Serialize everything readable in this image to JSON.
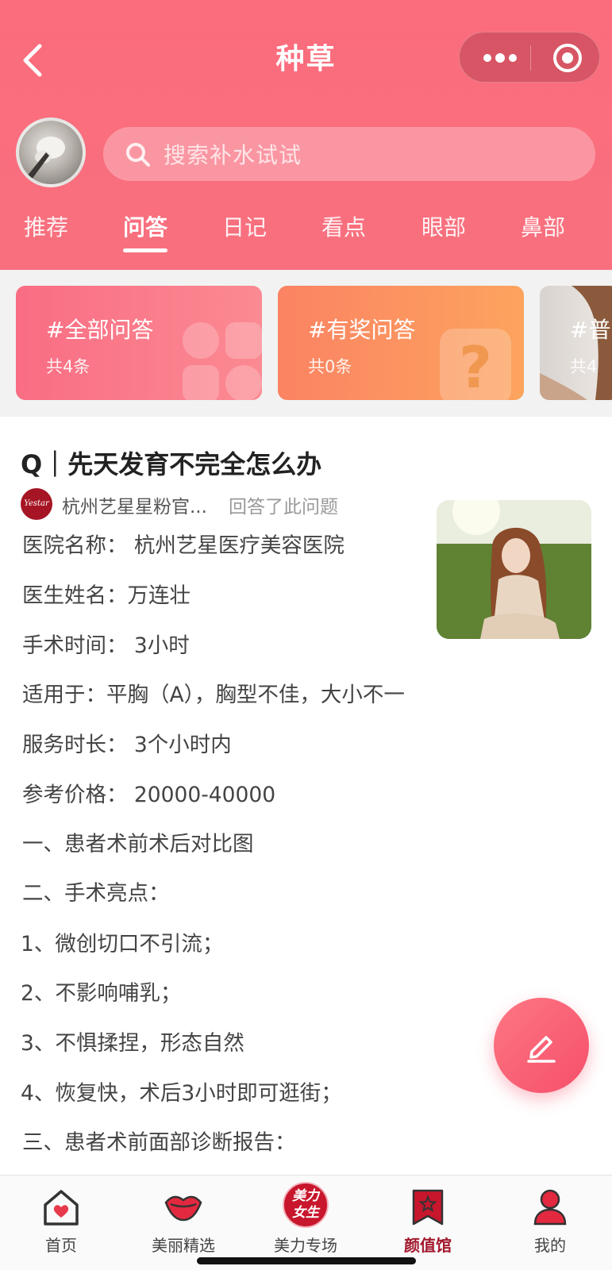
{
  "header": {
    "title": "种草",
    "search_placeholder": "搜索补水试试"
  },
  "tabs": [
    {
      "label": "推荐"
    },
    {
      "label": "问答"
    },
    {
      "label": "日记"
    },
    {
      "label": "看点"
    },
    {
      "label": "眼部"
    },
    {
      "label": "鼻部"
    }
  ],
  "active_tab": "问答",
  "topic_cards": [
    {
      "title": "#全部问答",
      "count": "共4条"
    },
    {
      "title": "#有奖问答",
      "count": "共0条"
    },
    {
      "title": "#普",
      "count": "共4"
    }
  ],
  "post": {
    "question": "Q｜先天发育不完全怎么办",
    "author": "杭州艺星星粉官...",
    "author_logo_text": "Yestar",
    "action": "回答了此问题",
    "lines": [
      "医院名称： 杭州艺星医疗美容医院",
      "医生姓名：万连壮",
      "手术时间： 3小时",
      "适用于：平胸（A），胸型不佳，大小不一",
      "服务时长： 3个小时内",
      "参考价格： 20000-40000",
      "一、患者术前术后对比图",
      "二、手术亮点：",
      "1、微创切口不引流；",
      "2、不影响哺乳；",
      "3、不惧揉捏，形态自然",
      "4、恢复快，术后3小时即可逛街；",
      "三、患者术前面部诊断报告："
    ]
  },
  "tabbar": [
    {
      "label": "首页",
      "icon": "home-heart-icon"
    },
    {
      "label": "美丽精选",
      "icon": "lips-icon"
    },
    {
      "label": "美力专场",
      "icon": "beauty-badge-icon",
      "badge_text": "美力女生"
    },
    {
      "label": "颜值馆",
      "icon": "bookmark-star-icon"
    },
    {
      "label": "我的",
      "icon": "person-icon"
    }
  ],
  "active_tabbar": "颜值馆",
  "colors": {
    "header": "#f96f7d",
    "active_tabbar": "#a3182d",
    "fab": "#f8606f"
  }
}
